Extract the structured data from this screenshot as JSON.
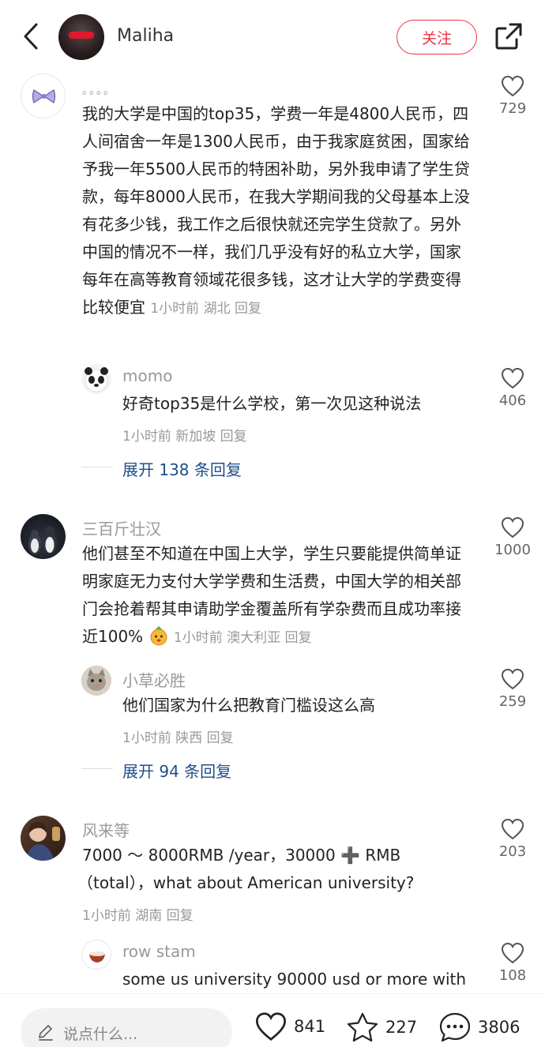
{
  "header": {
    "username": "Maliha",
    "follow_label": "关注"
  },
  "comments": [
    {
      "name": "。。。。",
      "text": "我的大学是中国的top35，学费一年是4800人民币，四人间宿舍一年是1300人民币，由于我家庭贫困，国家给予我一年5500人民币的特困补助，另外我申请了学生贷款，每年8000人民币，在我大学期间我的父母基本上没有花多少钱，我工作之后很快就还完学生贷款了。另外中国的情况不一样，我们几乎没有好的私立大学，国家每年在高等教育领域花很多钱，这才让大学的学费变得比较便宜",
      "meta": "1小时前 湖北 回复",
      "likes": "729",
      "reply": {
        "name": "momo",
        "text": "好奇top35是什么学校，第一次见这种说法",
        "meta": "1小时前 新加坡 回复",
        "likes": "406"
      },
      "expand": "展开 138 条回复"
    },
    {
      "name": "三百斤壮汉",
      "text": "他们甚至不知道在中国上大学，学生只要能提供简单证明家庭无力支付大学学费和生活费，中国大学的相关部门会抢着帮其申请助学金覆盖所有学杂费而且成功率接近100%",
      "meta": "1小时前 澳大利亚 回复",
      "likes": "1000",
      "reply": {
        "name": "小草必胜",
        "text": "他们国家为什么把教育门槛设这么高",
        "meta": "1小时前 陕西 回复",
        "likes": "259"
      },
      "expand": "展开 94 条回复"
    },
    {
      "name": "风来等",
      "text_line1": "7000 ～ 8000RMB /year，30000 ➕ RMB",
      "text_line2": "（total），what about American university?",
      "meta": "1小时前 湖南 回复",
      "likes": "203",
      "reply": {
        "name": "row stam",
        "text": "some us university 90000 usd or more with",
        "likes": "108"
      }
    }
  ],
  "bottom": {
    "placeholder": "说点什么...",
    "likes": "841",
    "favorites": "227",
    "comments": "3806"
  },
  "colors": {
    "accent_red": "#e9344a",
    "link_blue": "#1f4f8a",
    "meta_gray": "#999999"
  },
  "icons": [
    "back-chevron-icon",
    "share-icon",
    "heart-icon",
    "star-icon",
    "comment-bubble-icon",
    "pen-icon"
  ]
}
